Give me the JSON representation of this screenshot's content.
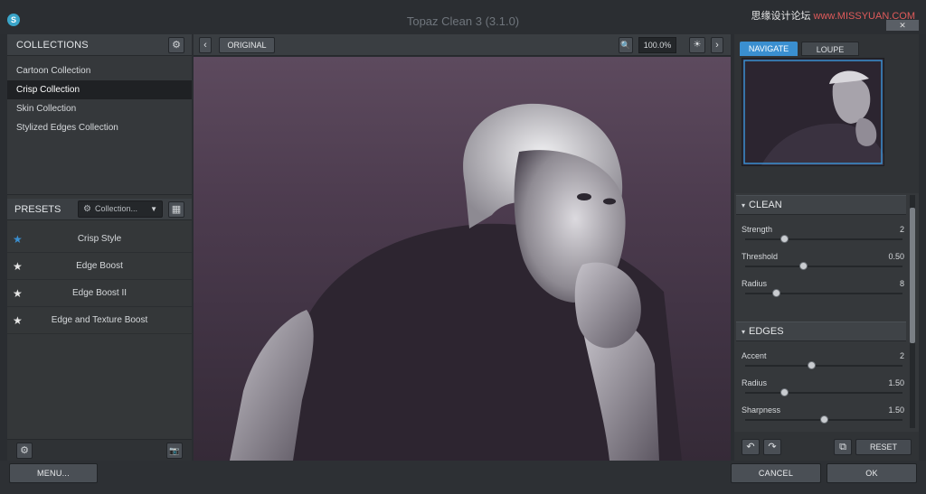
{
  "window": {
    "title": "Topaz Clean 3 (3.1.0)",
    "logo_glyph": "S",
    "watermark": "思缘设计论坛",
    "watermark_site": "www.MISSYUAN.COM"
  },
  "collections": {
    "header": "COLLECTIONS",
    "settings_icon": "⚙",
    "items": [
      {
        "label": "Cartoon Collection",
        "selected": false
      },
      {
        "label": "Crisp Collection",
        "selected": true
      },
      {
        "label": "Skin Collection",
        "selected": false
      },
      {
        "label": "Stylized Edges Collection",
        "selected": false
      }
    ]
  },
  "presets": {
    "header": "PRESETS",
    "dropdown": "Collection...",
    "dropdown_icon": "⚙",
    "dropdown_caret": "▼",
    "grid_icon": "▦",
    "items": [
      {
        "label": "Crisp Style",
        "star_color": "#3a8fd0"
      },
      {
        "label": "Edge Boost",
        "star_color": "#e6e6e6"
      },
      {
        "label": "Edge Boost II",
        "star_color": "#e6e6e6"
      },
      {
        "label": "Edge and Texture Boost",
        "star_color": "#e6e6e6"
      }
    ],
    "star_glyph": "★"
  },
  "left_footer": {
    "settings_icon": "⚙",
    "camera_icon": "📷"
  },
  "toolbar": {
    "prev_arrow": "‹",
    "next_arrow": "›",
    "original_label": "ORIGINAL",
    "zoom_icon": "🔍",
    "zoom_value": "100.0%",
    "light_icon": "☀"
  },
  "navigator": {
    "tabs": [
      "NAVIGATE",
      "LOUPE"
    ],
    "active_tab": "NAVIGATE"
  },
  "adjustments": {
    "sections": [
      {
        "title": "CLEAN",
        "sliders": [
          {
            "label": "Strength",
            "value": "2",
            "fraction": 0.25
          },
          {
            "label": "Threshold",
            "value": "0.50",
            "fraction": 0.37
          },
          {
            "label": "Radius",
            "value": "8",
            "fraction": 0.2
          }
        ]
      },
      {
        "title": "EDGES",
        "sliders": [
          {
            "label": "Accent",
            "value": "2",
            "fraction": 0.42
          },
          {
            "label": "Radius",
            "value": "1.50",
            "fraction": 0.25
          },
          {
            "label": "Sharpness",
            "value": "1.50",
            "fraction": 0.5
          }
        ]
      }
    ],
    "triangle_glyph": "▾"
  },
  "right_footer": {
    "undo_icon": "↶",
    "redo_icon": "↷",
    "stamp_icon": "⧉",
    "reset_label": "RESET"
  },
  "bottom": {
    "menu_label": "MENU...",
    "cancel_label": "CANCEL",
    "ok_label": "OK"
  },
  "colors": {
    "accent": "#3a8fd0",
    "navigator_frame": "#3a8fd0",
    "preview_background": "#4d3c4f"
  }
}
